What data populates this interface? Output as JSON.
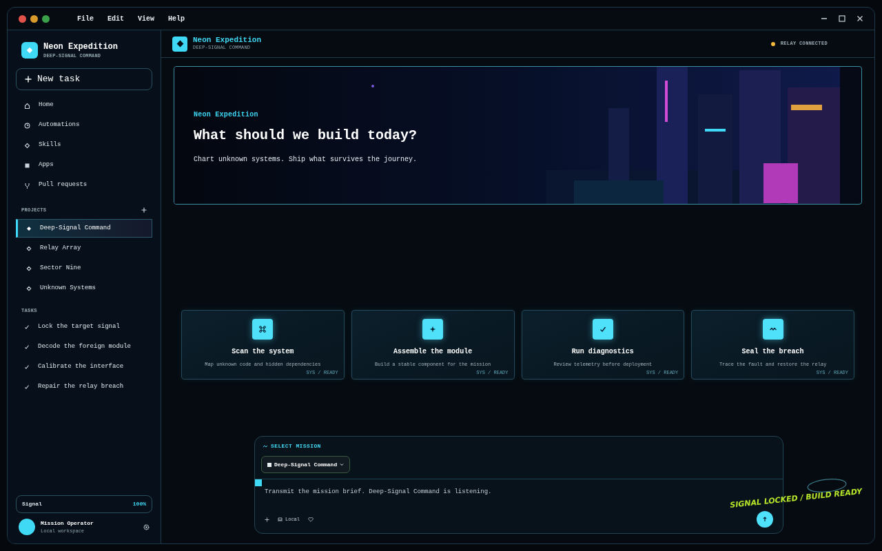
{
  "window": {
    "menu": [
      "File",
      "Edit",
      "View",
      "Help"
    ]
  },
  "sidebar": {
    "brand": {
      "title": "Neon Expedition",
      "subtitle": "DEEP-SIGNAL COMMAND"
    },
    "new_task": "New task",
    "nav": [
      {
        "label": "Home"
      },
      {
        "label": "Automations"
      },
      {
        "label": "Skills"
      },
      {
        "label": "Apps"
      },
      {
        "label": "Pull requests"
      }
    ],
    "projects": {
      "heading": "PROJECTS",
      "items": [
        {
          "label": "Deep-Signal Command",
          "selected": true
        },
        {
          "label": "Relay Array",
          "selected": false
        },
        {
          "label": "Sector Nine",
          "selected": false
        },
        {
          "label": "Unknown Systems",
          "selected": false
        }
      ]
    },
    "tasks": {
      "heading": "TASKS",
      "items": [
        {
          "label": "Lock the target signal",
          "done": true
        },
        {
          "label": "Decode the foreign module",
          "done": true
        },
        {
          "label": "Calibrate the interface",
          "done": true
        },
        {
          "label": "Repair the relay breach",
          "done": true
        }
      ]
    },
    "signal": {
      "label": "Signal",
      "value": "100%"
    },
    "user": {
      "name": "Mission Operator",
      "subtitle": "Local workspace"
    }
  },
  "header": {
    "title": "Neon Expedition",
    "subtitle": "DEEP-SIGNAL COMMAND",
    "status": "RELAY CONNECTED"
  },
  "hero": {
    "eyebrow": "Neon Expedition",
    "title": "What should we build today?",
    "subtitle": "Chart unknown systems. Ship what survives the journey."
  },
  "cards": [
    {
      "title": "Scan the system",
      "description": "Map unknown code and hidden dependencies",
      "footer": "SYS / READY"
    },
    {
      "title": "Assemble the module",
      "description": "Build a stable component for the mission",
      "footer": "SYS / READY"
    },
    {
      "title": "Run diagnostics",
      "description": "Review telemetry before deployment",
      "footer": "SYS / READY"
    },
    {
      "title": "Seal the breach",
      "description": "Trace the fault and restore the relay",
      "footer": "SYS / READY"
    }
  ],
  "composer": {
    "heading": "SELECT MISSION",
    "project": "Deep-Signal Command",
    "placeholder": "Transmit the mission brief. Deep-Signal Command is listening.",
    "mode": "Local"
  },
  "annotation": "SIGNAL LOCKED / BUILD READY"
}
